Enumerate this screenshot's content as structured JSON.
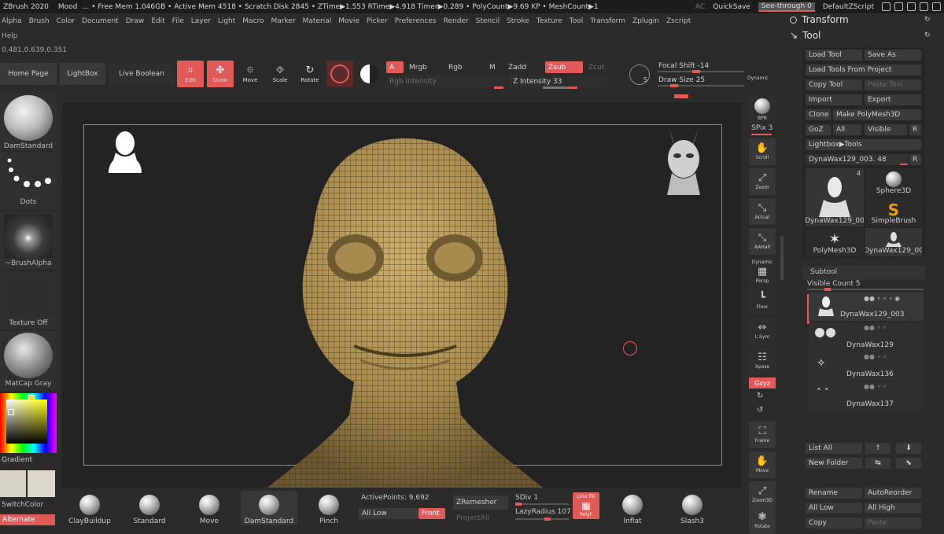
{
  "statusbar": {
    "app": "ZBrush 2020",
    "mood": "Mood",
    "stats": "… • Free Mem 1.046GB • Active Mem 4518 • Scratch Disk 2845 • ZTime▶1.553 RTime▶4.918 Timer▶0.289 • PolyCount▶9.69 KP • MeshCount▶1",
    "ac": "AC",
    "quicksave": "QuickSave",
    "see_through_label": "See-through",
    "see_through_value": "0",
    "script": "DefaultZScript"
  },
  "menu": [
    "Alpha",
    "Brush",
    "Color",
    "Document",
    "Draw",
    "Edit",
    "File",
    "Layer",
    "Light",
    "Macro",
    "Marker",
    "Material",
    "Movie",
    "Picker",
    "Preferences",
    "Render",
    "Stencil",
    "Stroke",
    "Texture",
    "Tool",
    "Transform",
    "Zplugin",
    "Zscript"
  ],
  "help": "Help",
  "coords": "0.481,0.639,0.351",
  "toolbar": {
    "home": "Home Page",
    "lightbox": "LightBox",
    "live_boolean": "Live Boolean",
    "edit": "Edit",
    "draw": "Draw",
    "move": "Move",
    "scale": "Scale",
    "rotate": "Rotate",
    "a": "A",
    "mrgb": "Mrgb",
    "rgb": "Rgb",
    "m": "M",
    "zadd": "Zadd",
    "zsub": "Zsub",
    "zcut": "Zcut",
    "rgb_intensity": "Rgb Intensity",
    "z_intensity": "Z Intensity 33",
    "focal_shift": "Focal Shift -14",
    "draw_size": "Draw Size 25",
    "dynamic": "Dynamic",
    "s_badge": "S"
  },
  "left_shelf": {
    "brush": "DamStandard",
    "stroke": "Dots",
    "alpha": "~BrushAlpha",
    "texture": "Texture Off",
    "material": "MatCap Gray",
    "gradient": "Gradient",
    "switch_color": "SwitchColor",
    "alternate": "Alternate"
  },
  "right_rail": {
    "bpr": "BPR",
    "spix": "SPix 3",
    "scroll": "Scroll",
    "zoom": "Zoom",
    "actual": "Actual",
    "aahalf": "AAHalf",
    "dynamic": "Dynamic",
    "persp": "Persp",
    "floor": "Floor",
    "lsym": "L.Sym",
    "xpose": "Xpose",
    "gxyz": "Gxyz",
    "frame": "Frame",
    "move": "Move",
    "zoom3d": "Zoom3D",
    "rotate": "Rotate"
  },
  "panel": {
    "transform": "Transform",
    "tool": "Tool",
    "load_tool": "Load Tool",
    "save_as": "Save As",
    "load_from_project": "Load Tools From Project",
    "copy_tool": "Copy Tool",
    "paste_tool": "Paste Tool",
    "import": "Import",
    "export": "Export",
    "clone": "Clone",
    "make_polymesh": "Make PolyMesh3D",
    "goz": "GoZ",
    "all": "All",
    "visible": "Visible",
    "r": "R",
    "lightbox_tools": "Lightbox▶Tools",
    "current_tool": "DynaWax129_003. 48",
    "thumb_count": "4",
    "thumb1": "DynaWax129_00",
    "thumb2": "Sphere3D",
    "thumb3": "SimpleBrush",
    "thumb4": "PolyMesh3D",
    "thumb5": "DynaWax129_00",
    "subtool": "Subtool",
    "visible_count": "Visible Count 5",
    "subtools": [
      "DynaWax129_003",
      "DynaWax129",
      "DynaWax136",
      "DynaWax137"
    ],
    "list_all": "List All",
    "new_folder": "New Folder",
    "rename": "Rename",
    "autoreorder": "AutoReorder",
    "all_low": "All Low",
    "all_high": "All High",
    "copy": "Copy",
    "paste": "Paste"
  },
  "bottom": {
    "brushes": [
      "ClayBuildup",
      "Standard",
      "Move",
      "DamStandard",
      "Pinch",
      "Inflat",
      "Slash3"
    ],
    "active_points": "ActivePoints: 9,692",
    "all_low": "All Low",
    "front": "Front",
    "zremesher": "ZRemesher",
    "projectall": "ProjectAll",
    "sdiv": "SDiv 1",
    "lazy_radius": "LazyRadius 107",
    "line_fill": "Line Fill",
    "polyf": "PolyF"
  },
  "colors": {
    "accent": "#e05a5a",
    "bg": "#2b2b2b",
    "viewport": "#232323",
    "mesh": "#b89a5c"
  }
}
